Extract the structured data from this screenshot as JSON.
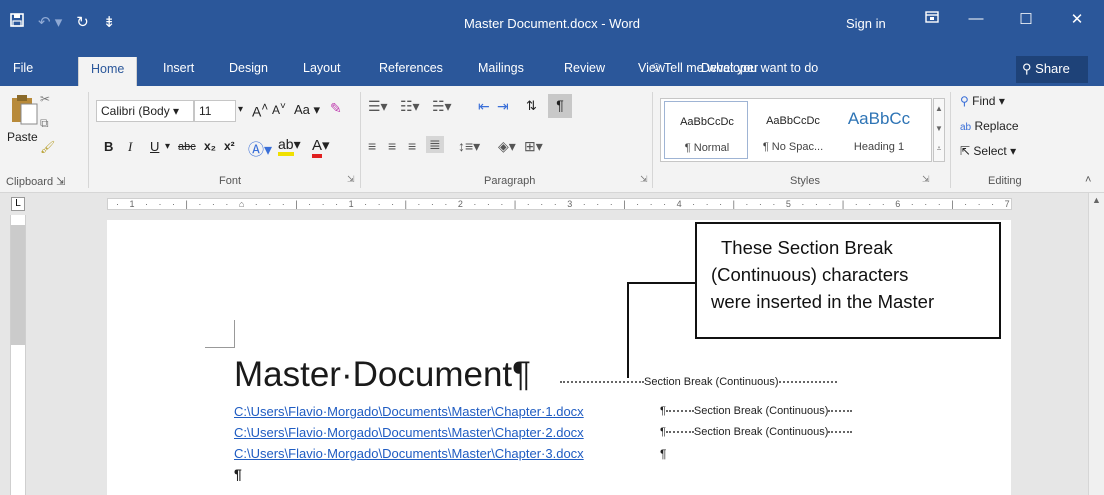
{
  "app": {
    "title": "Master Document.docx - Word",
    "sign_in": "Sign in",
    "qat": {
      "save_icon": "save-icon",
      "undo_icon": "undo-icon",
      "redo_icon": "redo-icon",
      "customize_icon": "qat-customize-icon"
    },
    "window_buttons": {
      "ribbon_display": "ribbon-display-options-icon",
      "minimize": "minimize-icon",
      "maximize": "maximize-icon",
      "close": "close-icon"
    }
  },
  "tabs": [
    "File",
    "Home",
    "Insert",
    "Design",
    "Layout",
    "References",
    "Mailings",
    "Review",
    "View",
    "Developer"
  ],
  "active_tab": "Home",
  "tell_me": "Tell me what you want to do",
  "share": "Share",
  "ribbon": {
    "clipboard": {
      "label": "Clipboard",
      "paste": "Paste"
    },
    "font": {
      "label": "Font",
      "font_name": "Calibri (Body",
      "font_size": "11",
      "change_case": "Aa",
      "bold": "B",
      "italic": "I",
      "underline": "U",
      "strikethrough": "abc",
      "subscript": "x₂",
      "superscript": "x²"
    },
    "paragraph": {
      "label": "Paragraph"
    },
    "styles": {
      "label": "Styles",
      "items": [
        {
          "preview": "AaBbCcDc",
          "name": "¶ Normal"
        },
        {
          "preview": "AaBbCcDc",
          "name": "¶ No Spac..."
        },
        {
          "preview": "AaBbCc",
          "name": "Heading 1"
        }
      ]
    },
    "editing": {
      "label": "Editing",
      "find": "Find",
      "replace": "Replace",
      "select": "Select"
    }
  },
  "ruler": {
    "text": "· 1 · · · | · · · ⌂ · · · | · · · 1 · · · | · · · 2 · · · | · · · 3 · · · | · · · 4 · · · | · · · 5 · · · | · · · 6 · · · | · · · 7"
  },
  "document": {
    "heading": "Master·Document¶",
    "section_break": "Section Break (Continuous)",
    "links": [
      "C:\\Users\\Flavio·Morgado\\Documents\\Master\\Chapter·1.docx",
      "C:\\Users\\Flavio·Morgado\\Documents\\Master\\Chapter·2.docx",
      "C:\\Users\\Flavio·Morgado\\Documents\\Master\\Chapter·3.docx"
    ],
    "pilcrow": "¶",
    "last_pilcrow": "¶"
  },
  "callout": {
    "lines": [
      "These Section Break",
      "(Continuous) characters",
      "were inserted in the Master"
    ]
  }
}
